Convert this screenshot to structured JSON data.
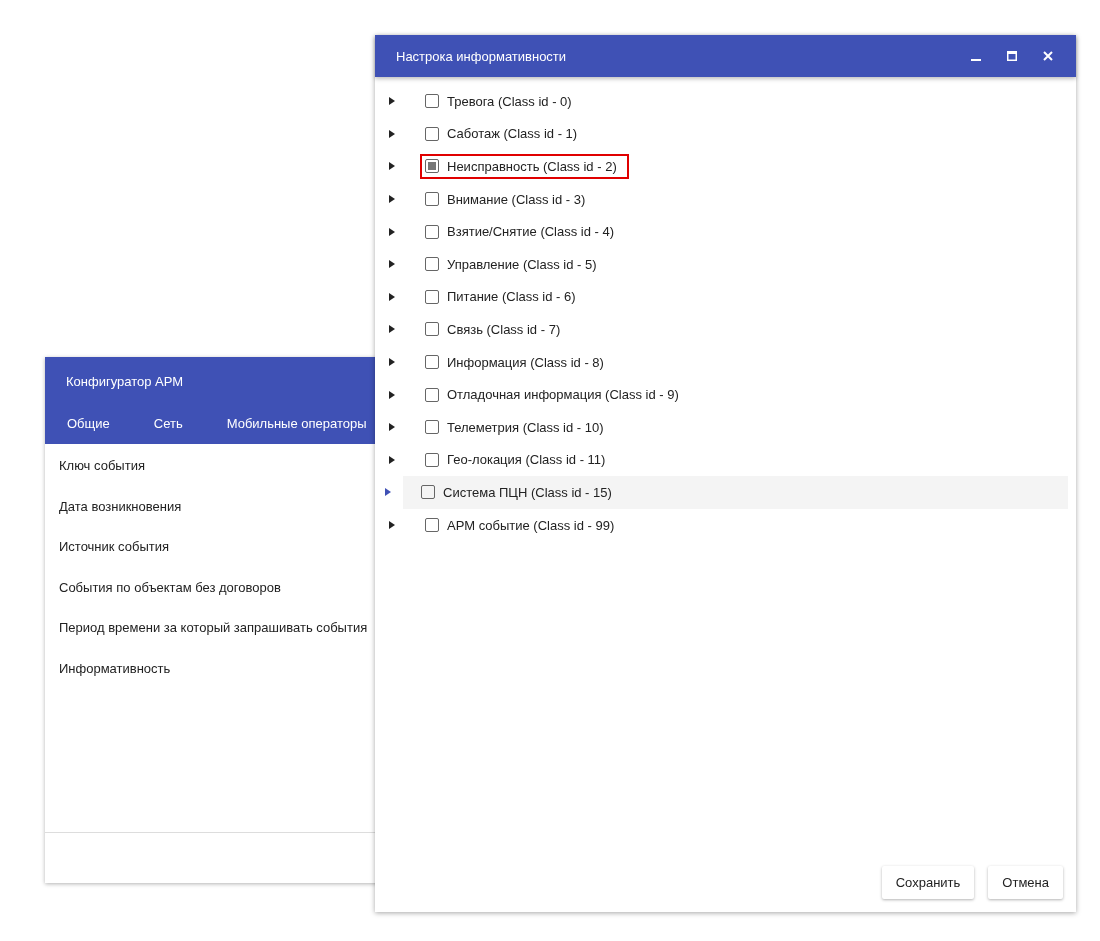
{
  "back_window": {
    "title": "Конфигуратор АРМ",
    "tabs": [
      "Общие",
      "Сеть",
      "Мобильные операторы"
    ],
    "fields": [
      "Ключ события",
      "Дата возникновения",
      "Источник события",
      "События по объектам без договоров",
      "Период времени за который запрашивать события",
      "Информативность"
    ]
  },
  "dialog": {
    "title": "Настрока информативности",
    "items": [
      {
        "label": "Тревога (Class id - 0)",
        "checked": false,
        "indeterminate": false,
        "hovered": false,
        "highlighted": false
      },
      {
        "label": "Саботаж (Class id - 1)",
        "checked": false,
        "indeterminate": false,
        "hovered": false,
        "highlighted": false
      },
      {
        "label": "Неисправность (Class id - 2)",
        "checked": false,
        "indeterminate": true,
        "hovered": false,
        "highlighted": true
      },
      {
        "label": "Внимание (Class id - 3)",
        "checked": false,
        "indeterminate": false,
        "hovered": false,
        "highlighted": false
      },
      {
        "label": "Взятие/Снятие (Class id - 4)",
        "checked": false,
        "indeterminate": false,
        "hovered": false,
        "highlighted": false
      },
      {
        "label": "Управление (Class id - 5)",
        "checked": false,
        "indeterminate": false,
        "hovered": false,
        "highlighted": false
      },
      {
        "label": "Питание (Class id - 6)",
        "checked": false,
        "indeterminate": false,
        "hovered": false,
        "highlighted": false
      },
      {
        "label": "Связь (Class id - 7)",
        "checked": false,
        "indeterminate": false,
        "hovered": false,
        "highlighted": false
      },
      {
        "label": "Информация (Class id - 8)",
        "checked": false,
        "indeterminate": false,
        "hovered": false,
        "highlighted": false
      },
      {
        "label": "Отладочная информация (Class id - 9)",
        "checked": false,
        "indeterminate": false,
        "hovered": false,
        "highlighted": false
      },
      {
        "label": "Телеметрия (Class id - 10)",
        "checked": false,
        "indeterminate": false,
        "hovered": false,
        "highlighted": false
      },
      {
        "label": "Гео-локация (Class id - 11)",
        "checked": false,
        "indeterminate": false,
        "hovered": false,
        "highlighted": false
      },
      {
        "label": "Система ПЦН (Class id - 15)",
        "checked": false,
        "indeterminate": false,
        "hovered": true,
        "highlighted": false
      },
      {
        "label": "АРМ событие (Class id - 99)",
        "checked": false,
        "indeterminate": false,
        "hovered": false,
        "highlighted": false
      }
    ],
    "buttons": [
      "Сохранить",
      "Отмена"
    ]
  }
}
